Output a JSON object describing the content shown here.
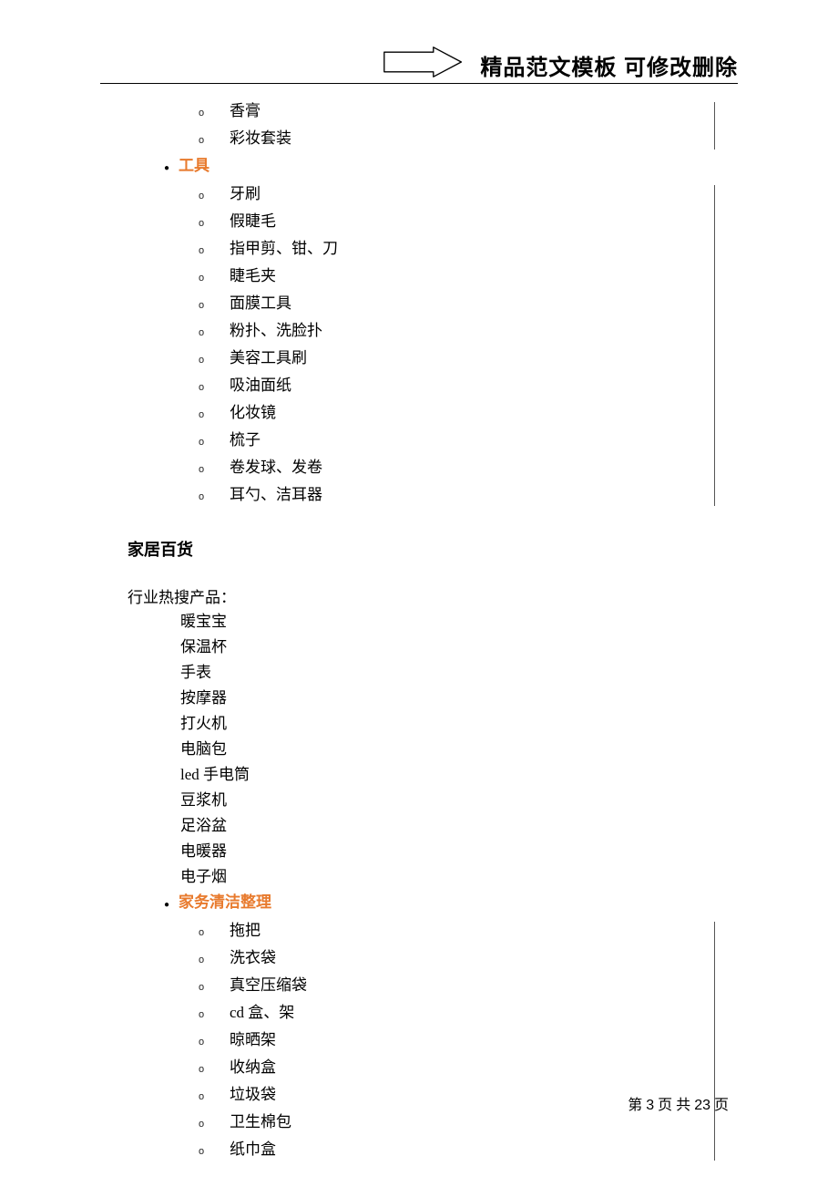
{
  "header": {
    "title": "精品范文模板  可修改删除"
  },
  "sections": {
    "intro_sub": [
      "香膏",
      "彩妆套装"
    ],
    "cat_tools": {
      "label": "工具",
      "items": [
        "牙刷",
        "假睫毛",
        "指甲剪、钳、刀",
        "睫毛夹",
        "面膜工具",
        "粉扑、洗脸扑",
        "美容工具刷",
        "吸油面纸",
        "化妆镜",
        "梳子",
        "卷发球、发卷",
        "耳勺、洁耳器"
      ]
    },
    "home_heading": "家居百货",
    "hot_label": "行业热搜产品：",
    "hot_items": [
      "暖宝宝",
      "保温杯",
      "手表",
      "按摩器",
      "打火机",
      "电脑包",
      "led 手电筒",
      "豆浆机",
      "足浴盆",
      "电暖器",
      "电子烟"
    ],
    "cat_clean": {
      "label": "家务清洁整理",
      "items": [
        "拖把",
        "洗衣袋",
        "真空压缩袋",
        "cd 盒、架",
        "晾晒架",
        "收纳盒",
        "垃圾袋",
        "卫生棉包",
        "纸巾盒"
      ]
    }
  },
  "footer": {
    "prefix": "第",
    "current": "3",
    "mid": "页 共",
    "total": "23",
    "suffix": "页"
  }
}
